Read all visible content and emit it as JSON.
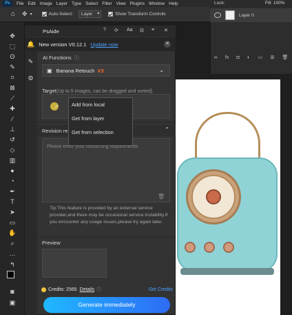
{
  "menubar": {
    "items": [
      "File",
      "Edit",
      "Image",
      "Layer",
      "Type",
      "Select",
      "Filter",
      "View",
      "Plugins",
      "Window",
      "Help"
    ],
    "lock_label": "Lock:",
    "fill_label": "Fill:",
    "fill_value": "100%"
  },
  "options": {
    "auto_select_label": "Auto-Select:",
    "auto_select_value": "Layer",
    "transform_label": "Show Transform Controls"
  },
  "layers": {
    "layer_name": "Layer 0"
  },
  "panel": {
    "title": "PsAide",
    "notice_text": "New version V0.12.1",
    "update_link": "Update now",
    "ai_functions_label": "AI Functions",
    "function_value": "Banana Retouch",
    "function_badge": "V3",
    "target_label": "Target",
    "target_hint": "(Up to 5 images, can be dragged and sorted)",
    "context_menu": [
      "Add from local",
      "Get from layer",
      "Get from selection"
    ],
    "revision_label": "Revision re",
    "revision_placeholder": "Please enter your retouching requirements",
    "tip_text": "Tip:This feature is provided by an external service provider,and there may be occasional service instability.If you encounter any usage issues,please try again later.",
    "preview_label": "Preview",
    "credits_label": "Credits: 2565",
    "details_link": "Details",
    "get_credits_link": "Get Credits",
    "generate_button": "Generate immediately"
  },
  "colors": {
    "accent_blue": "#4da3ff",
    "badge_orange": "#ff6a2a",
    "generate_start": "#1fb8ff",
    "generate_end": "#2e6cf5"
  }
}
